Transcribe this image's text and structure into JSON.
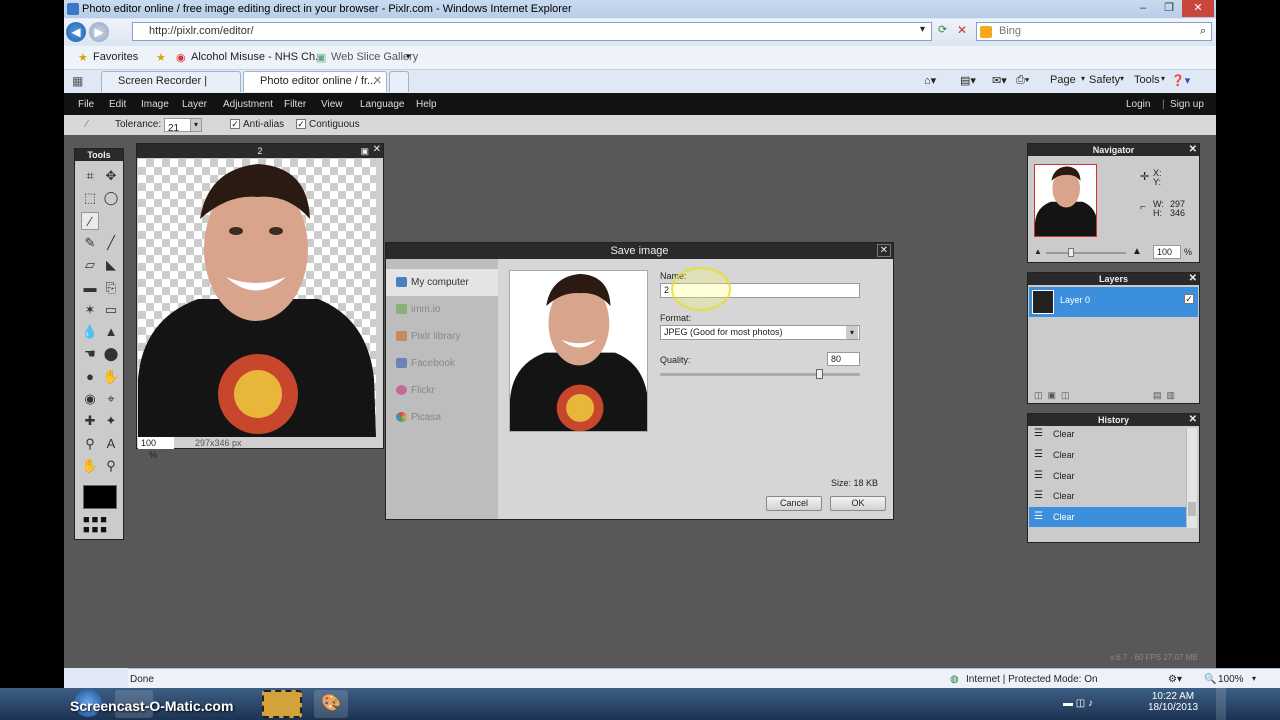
{
  "window": {
    "title": "Photo editor online / free image editing direct in your browser - Pixlr.com - Windows Internet Explorer"
  },
  "address": {
    "url": "http://pixlr.com/editor/",
    "search_placeholder": "Bing"
  },
  "favorites": {
    "label": "Favorites",
    "items": [
      "Alcohol Misuse - NHS Ch...",
      "Web Slice Gallery"
    ]
  },
  "tabs": [
    {
      "label": "Screen Recorder | Screenca..."
    },
    {
      "label": "Photo editor online / fr..."
    }
  ],
  "commandbar": {
    "page": "Page",
    "safety": "Safety",
    "tools": "Tools"
  },
  "menu": {
    "items": [
      "File",
      "Edit",
      "Image",
      "Layer",
      "Adjustment",
      "Filter",
      "View",
      "Language",
      "Help"
    ],
    "login": "Login",
    "signup": "Sign up"
  },
  "options": {
    "tolerance_label": "Tolerance:",
    "tolerance_value": "21",
    "antialias": "Anti-alias",
    "contiguous": "Contiguous"
  },
  "tools": {
    "title": "Tools"
  },
  "image_window": {
    "title": "2",
    "zoom": "100",
    "zoom_unit": "%",
    "dims": "297x346 px"
  },
  "dialog": {
    "title": "Save image",
    "sources": [
      "My computer",
      "imm.io",
      "Pixlr library",
      "Facebook",
      "Flickr",
      "Picasa"
    ],
    "name_label": "Name:",
    "name_value": "2",
    "format_label": "Format:",
    "format_value": "JPEG (Good for most photos)",
    "quality_label": "Quality:",
    "quality_value": "80",
    "quality_fraction": 0.8,
    "size": "Size: 18 KB",
    "cancel": "Cancel",
    "ok": "OK"
  },
  "navigator": {
    "title": "Navigator",
    "x": "X:",
    "y": "Y:",
    "w_label": "W:",
    "w": "297",
    "h_label": "H:",
    "h": "346",
    "zoom": "100",
    "zoom_unit": "%"
  },
  "layers": {
    "title": "Layers",
    "items": [
      "Layer 0"
    ]
  },
  "history": {
    "title": "History",
    "items": [
      "Clear",
      "Clear",
      "Clear",
      "Clear",
      "Clear"
    ]
  },
  "version": "v:6.7 - 60 FPS 27.07 MB",
  "status": {
    "done": "Done",
    "zone": "Internet | Protected Mode: On",
    "zoom": "100%"
  },
  "taskbar": {
    "watermark": "Screencast-O-Matic.com",
    "time": "10:22 AM",
    "date": "18/10/2013"
  },
  "colors": {
    "accent_blue": "#3b8fdc",
    "menubar": "#121212",
    "workspace": "#585858"
  }
}
